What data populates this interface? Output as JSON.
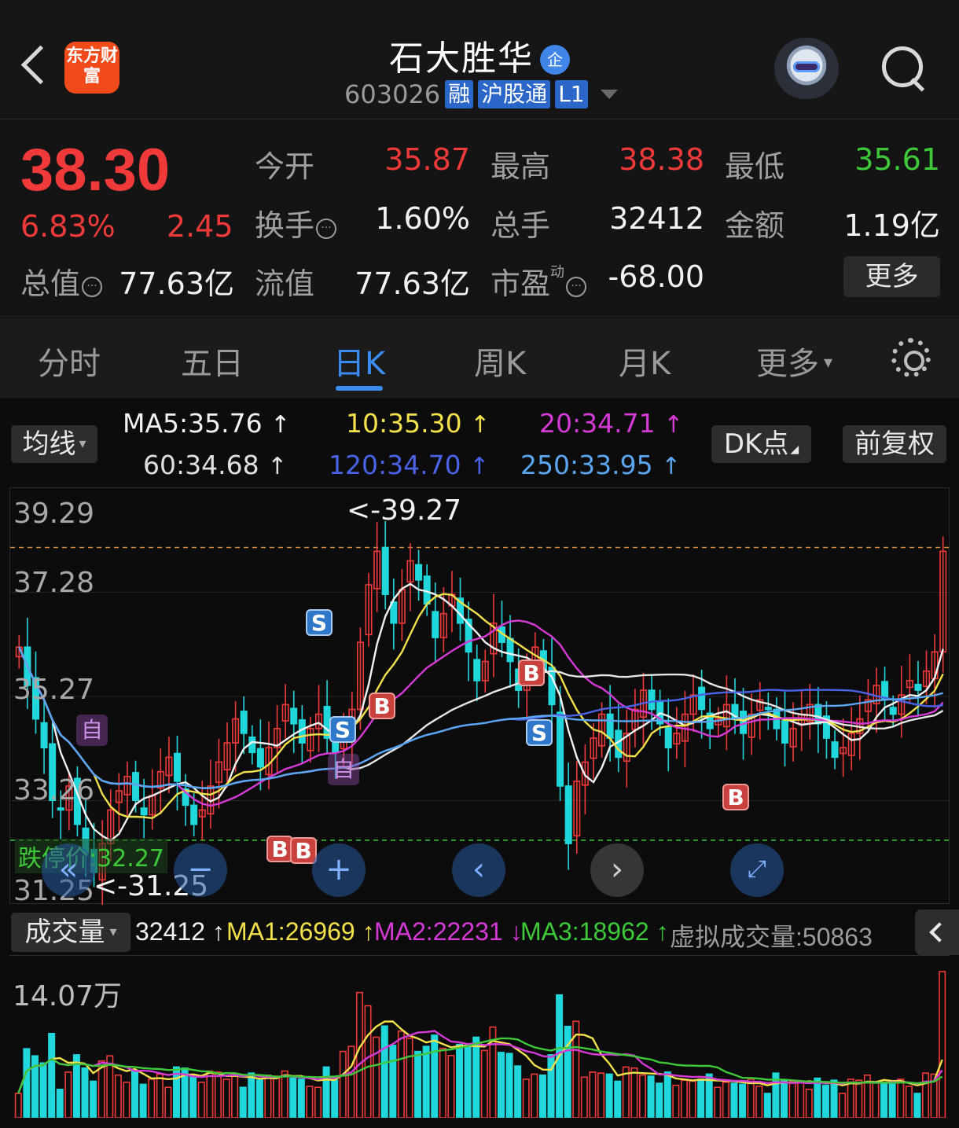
{
  "header": {
    "brand_logo_text": "东方财富",
    "stock_name": "石大胜华",
    "enterprise_badge": "企",
    "stock_code": "603026",
    "tags": [
      "融",
      "沪股通",
      "L1"
    ]
  },
  "quote": {
    "price": "38.30",
    "change_pct": "6.83%",
    "change_amt": "2.45",
    "open_label": "今开",
    "open_value": "35.87",
    "high_label": "最高",
    "high_value": "38.38",
    "low_label": "最低",
    "low_value": "35.61",
    "turnover_label": "换手",
    "turnover_value": "1.60%",
    "volume_label": "总手",
    "volume_value": "32412",
    "amount_label": "金额",
    "amount_value": "1.19亿",
    "mktcap_label": "总值",
    "mktcap_value": "77.63亿",
    "float_label": "流值",
    "float_value": "77.63亿",
    "pe_label": "市盈",
    "pe_sup": "动",
    "pe_value": "-68.00",
    "more_label": "更多"
  },
  "tabs": [
    "分时",
    "五日",
    "日K",
    "周K",
    "月K",
    "更多"
  ],
  "ma_header": {
    "selector": "均线",
    "ma5": "MA5:35.76",
    "ma10": "10:35.30",
    "ma20": "20:34.71",
    "ma60": "60:34.68",
    "ma120": "120:34.70",
    "ma250": "250:33.95",
    "dk_button": "DK点",
    "adjust_button": "前复权"
  },
  "price_chart": {
    "y_labels": [
      "39.29",
      "37.28",
      "35.27",
      "33.26",
      "31.25"
    ],
    "limit_down_label": "跌停价:32.27",
    "high_annotation": "<-39.27",
    "low_annotation": "<-31.25",
    "signal_labels": [
      "S",
      "B",
      "自"
    ]
  },
  "volume": {
    "selector": "成交量",
    "current": "32412",
    "ma1": "MA1:26969",
    "ma2": "MA2:22231",
    "ma3": "MA3:18962",
    "virtual": "虚拟成交量:50863",
    "y_label": "14.07万"
  },
  "colors": {
    "up": "#f03a3a",
    "down": "#20d8dc",
    "ma5": "#f2f2f2",
    "ma10": "#f2e14a",
    "ma20": "#d63ad6",
    "ma60": "#e6e6e6",
    "ma120": "#4a63e6",
    "ma250": "#5aa6f0",
    "accent": "#3b8cf2"
  },
  "chart_data": {
    "type": "candlestick",
    "ylim": [
      31.25,
      39.29
    ],
    "close": [
      36.3,
      35.5,
      34.8,
      34.2,
      33.1,
      32.9,
      33.4,
      32.6,
      32.0,
      31.6,
      32.2,
      32.9,
      33.3,
      33.6,
      33.1,
      32.8,
      33.2,
      33.7,
      34.0,
      33.5,
      33.0,
      32.6,
      32.9,
      33.4,
      33.9,
      34.3,
      34.8,
      34.5,
      34.1,
      33.8,
      34.2,
      34.6,
      35.1,
      34.7,
      34.3,
      34.6,
      34.9,
      34.4,
      34.1,
      34.5,
      35.0,
      36.4,
      37.6,
      38.3,
      37.4,
      36.8,
      37.5,
      38.1,
      37.7,
      37.2,
      36.5,
      37.0,
      37.4,
      36.8,
      36.2,
      35.6,
      36.0,
      36.8,
      36.4,
      36.0,
      35.4,
      35.8,
      36.3,
      35.8,
      35.1,
      33.4,
      32.2,
      33.5,
      33.9,
      34.4,
      34.9,
      34.4,
      34.0,
      34.5,
      35.0,
      35.4,
      35.0,
      34.7,
      34.2,
      34.5,
      34.9,
      35.3,
      35.0,
      34.6,
      34.8,
      35.1,
      34.8,
      34.5,
      34.9,
      35.2,
      35.0,
      34.6,
      34.3,
      34.6,
      34.9,
      35.1,
      34.7,
      34.4,
      34.0,
      34.2,
      34.5,
      34.8,
      35.2,
      35.5,
      35.2,
      34.9,
      35.3,
      35.6,
      35.4,
      35.8,
      36.2,
      38.3
    ]
  }
}
